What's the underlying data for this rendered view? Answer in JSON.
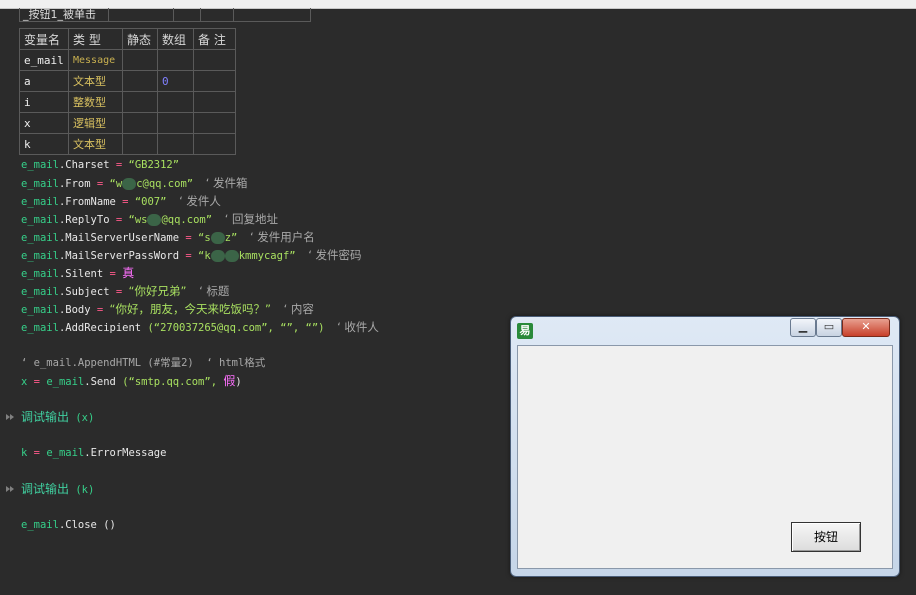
{
  "header": {
    "cells": [
      "_按钮1_被单击",
      "",
      "",
      "",
      ""
    ]
  },
  "vars_table": {
    "columns": [
      "变量名",
      "类 型",
      "静态",
      "数组",
      "备 注"
    ],
    "rows": [
      {
        "name": "e_mail",
        "type": "Message",
        "static": "",
        "array": "",
        "note": ""
      },
      {
        "name": "a",
        "type": "文本型",
        "static": "",
        "array": "0",
        "note": ""
      },
      {
        "name": "i",
        "type": "整数型",
        "static": "",
        "array": "",
        "note": ""
      },
      {
        "name": "x",
        "type": "逻辑型",
        "static": "",
        "array": "",
        "note": ""
      },
      {
        "name": "k",
        "type": "文本型",
        "static": "",
        "array": "",
        "note": ""
      }
    ]
  },
  "code": {
    "obj": "e_mail",
    "l1": {
      "member": ".Charset",
      "value": "“GB2312”"
    },
    "l2": {
      "member": ".From",
      "value_a": "“w",
      "value_b": "c@qq.com”",
      "comment": "‘ 发件箱"
    },
    "l3": {
      "member": ".FromName",
      "value": "“007”",
      "comment": "‘ 发件人"
    },
    "l4": {
      "member": ".ReplyTo",
      "value_a": "“ws",
      "value_b": "@qq.com”",
      "comment": "‘ 回复地址"
    },
    "l5": {
      "member": ".MailServerUserName",
      "value_a": "“s",
      "value_b": "z”",
      "comment": "‘ 发件用户名"
    },
    "l6": {
      "member": ".MailServerPassWord",
      "value_a": "“k",
      "value_b": "kmmycagf”",
      "comment": "‘ 发件密码"
    },
    "l7": {
      "member": ".Silent",
      "value": "真"
    },
    "l8": {
      "member": ".Subject",
      "value": "“你好兄弟”",
      "comment": "‘ 标题"
    },
    "l9": {
      "member": ".Body",
      "value": "“你好，朋友，今天来吃饭吗？”",
      "comment": "‘ 内容"
    },
    "l10": {
      "member": ".AddRecipient",
      "args": "(“270037265@qq.com”, “”, “”)",
      "comment": "‘ 收件人"
    },
    "l11": {
      "text": "‘ e_mail.AppendHTML (#常量2)  ‘ html格式"
    },
    "l12": {
      "var": "x",
      "member": ".Send",
      "args_a": "(“smtp.qq.com”,",
      "args_b": "假",
      "args_c": ")"
    },
    "l13": {
      "cmd": "调试输出",
      "args": "(x)"
    },
    "l14": {
      "var": "k",
      "member": ".ErrorMessage"
    },
    "l15": {
      "cmd": "调试输出",
      "args": "(k)"
    },
    "l16": {
      "member": ".Close",
      "args": "()"
    },
    "eq": "="
  },
  "dialog": {
    "icon_glyph": "易",
    "min_glyph": "▁",
    "max_glyph": "▭",
    "close_glyph": "✕",
    "button_label": "按钮"
  }
}
